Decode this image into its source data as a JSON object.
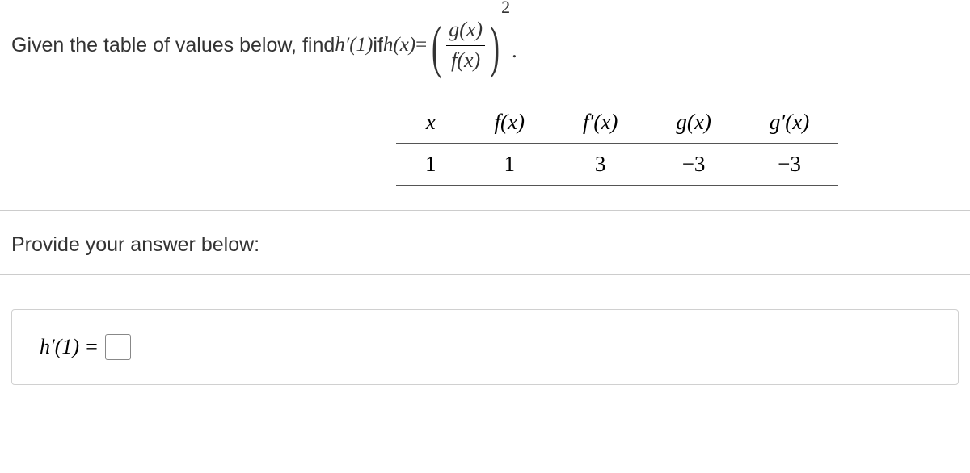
{
  "question": {
    "intro": "Given the table of values below, find ",
    "primequery": "h′(1)",
    "if_text": " if ",
    "func_name": "h(x)",
    "equals": " = ",
    "frac_num": "g(x)",
    "frac_den": "f(x)",
    "exponent": "2",
    "period": "."
  },
  "table": {
    "headers": {
      "x": "x",
      "fx": "f(x)",
      "fpx": "f′(x)",
      "gx": "g(x)",
      "gpx": "g′(x)"
    },
    "row": {
      "x": "1",
      "fx": "1",
      "fpx": "3",
      "gx": "−3",
      "gpx": "−3"
    }
  },
  "provide_label": "Provide your answer below:",
  "answer": {
    "lhs": "h′(1) =",
    "value": ""
  }
}
